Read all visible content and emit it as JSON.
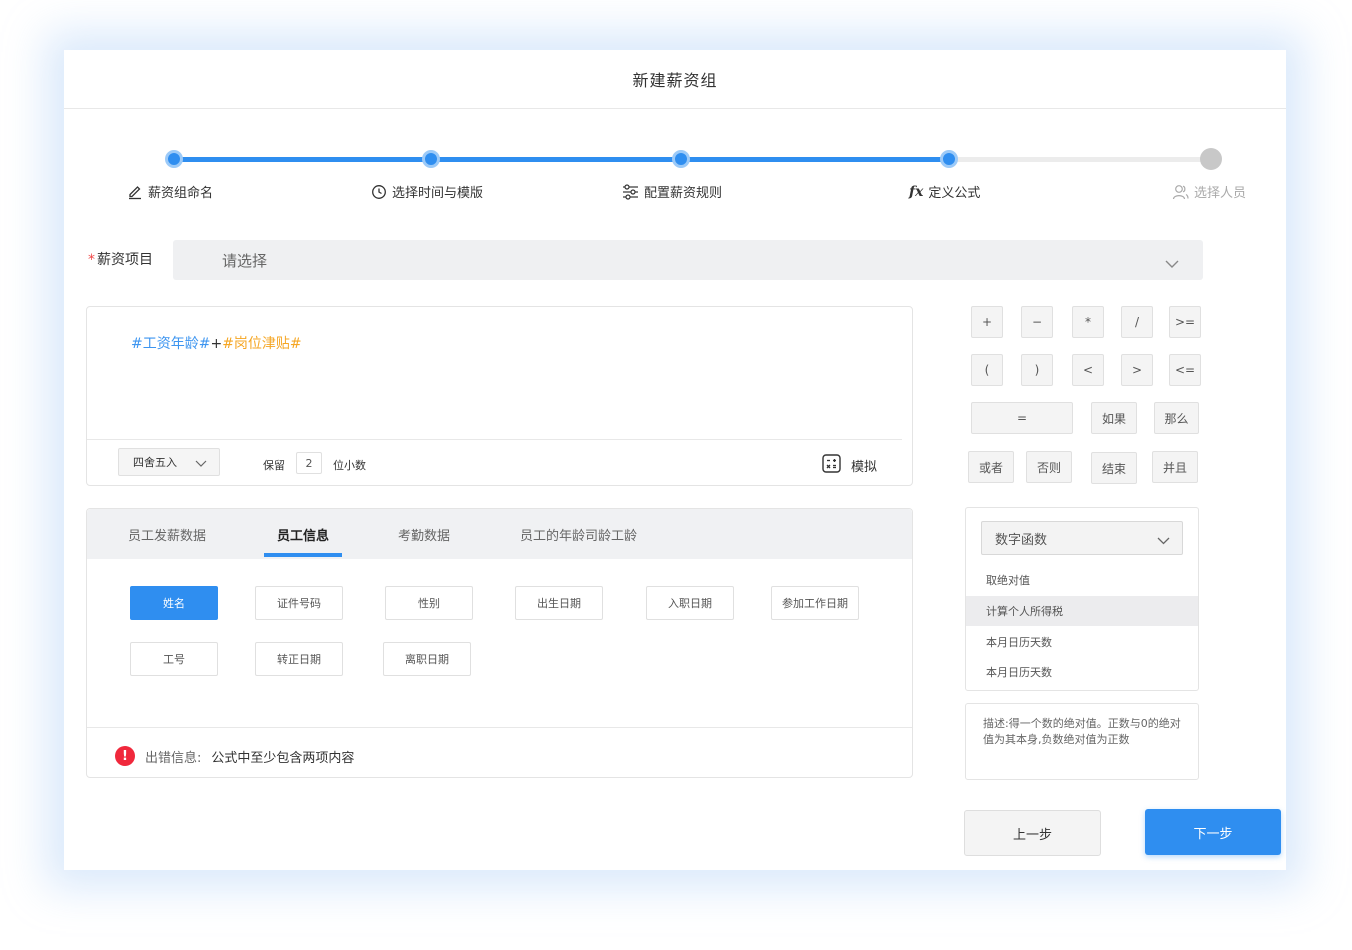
{
  "dialog": {
    "title": "新建薪资组"
  },
  "colors": {
    "accent": "#2f8ef0",
    "error": "#f0283c",
    "variable": "#3d95f0",
    "variable_alt": "#f5a623"
  },
  "stepper": {
    "steps": [
      {
        "label": "薪资组命名",
        "icon": "edit-icon",
        "status": "done"
      },
      {
        "label": "选择时间与模版",
        "icon": "clock-icon",
        "status": "done"
      },
      {
        "label": "配置薪资规则",
        "icon": "sliders-icon",
        "status": "done"
      },
      {
        "label": "定义公式",
        "icon": "fx-icon",
        "status": "current"
      },
      {
        "label": "选择人员",
        "icon": "user-icon",
        "status": "pending"
      }
    ]
  },
  "salary_item": {
    "required_mark": "*",
    "label": "薪资项目",
    "placeholder": "请选择"
  },
  "formula": {
    "var1": "#工资年龄#",
    "operator": "+",
    "var2": "#岗位津贴#"
  },
  "rounding": {
    "mode": "四舍五入",
    "keep_label": "保留",
    "digits": "2",
    "decimal_label": "位小数",
    "simulate_label": "模拟"
  },
  "tabs": [
    {
      "label": "员工发薪数据",
      "active": false
    },
    {
      "label": "员工信息",
      "active": true
    },
    {
      "label": "考勤数据",
      "active": false
    },
    {
      "label": "员工的年龄司龄工龄",
      "active": false
    }
  ],
  "fields": [
    "姓名",
    "证件号码",
    "性别",
    "出生日期",
    "入职日期",
    "参加工作日期",
    "工号",
    "转正日期",
    "离职日期"
  ],
  "error": {
    "icon": "!",
    "label": "出错信息:",
    "message": "公式中至少包含两项内容"
  },
  "operators": {
    "row1": [
      "+",
      "−",
      "*",
      "/",
      ">="
    ],
    "row2": [
      "(",
      ")",
      "<",
      ">",
      "<="
    ],
    "row3": [
      "=",
      "如果",
      "那么"
    ],
    "row4": [
      "或者",
      "否则",
      "结束",
      "并且"
    ]
  },
  "functions": {
    "category": "数字函数",
    "items": [
      "取绝对值",
      "计算个人所得税",
      "本月日历天数",
      "本月日历天数"
    ],
    "description": "描述:得一个数的绝对值。正数与0的绝对值为其本身,负数绝对值为正数"
  },
  "footer": {
    "prev_label": "上一步",
    "next_label": "下一步"
  }
}
